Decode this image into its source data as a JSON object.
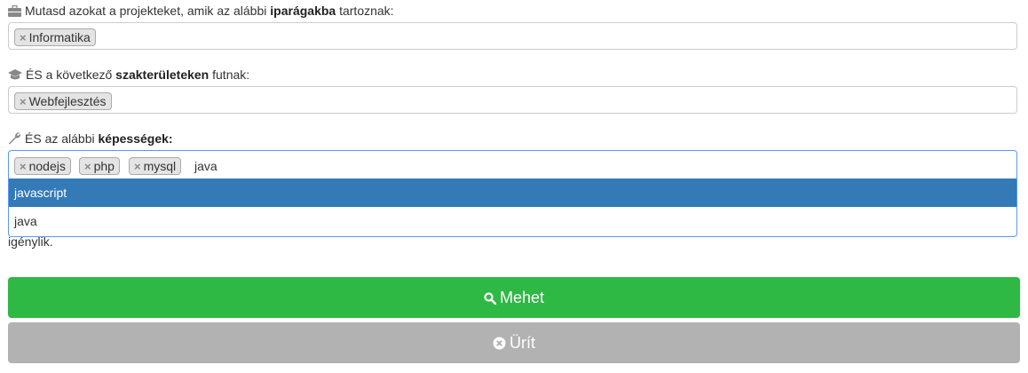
{
  "industries": {
    "label_prefix": "Mutasd azokat a projekteket, amik az alábbi",
    "label_bold": "iparágakba",
    "label_suffix": "tartoznak:",
    "icon": "briefcase-icon",
    "tags": [
      "Informatika"
    ]
  },
  "fields": {
    "label_prefix": "ÉS a következő",
    "label_bold": "szakterületeken",
    "label_suffix": "futnak:",
    "icon": "graduation-cap-icon",
    "tags": [
      "Webfejlesztés"
    ]
  },
  "skills": {
    "label_prefix": "ÉS az alábbi",
    "label_bold": "képességek:",
    "icon": "wrench-icon",
    "tags": [
      "nodejs",
      "php",
      "mysql"
    ],
    "input_value": "java",
    "options": [
      "javascript",
      "java"
    ],
    "highlighted": "javascript"
  },
  "partial_text": "igénylik.",
  "remove_symbol": "×",
  "buttons": {
    "search_label": "Mehet",
    "search_icon": "search-icon",
    "clear_label": "Ürít",
    "clear_icon": "times-circle-icon"
  },
  "colors": {
    "go": "#2eb844",
    "clear": "#b2b2b2",
    "highlight": "#337ab7",
    "focus_border": "#5897fb"
  }
}
